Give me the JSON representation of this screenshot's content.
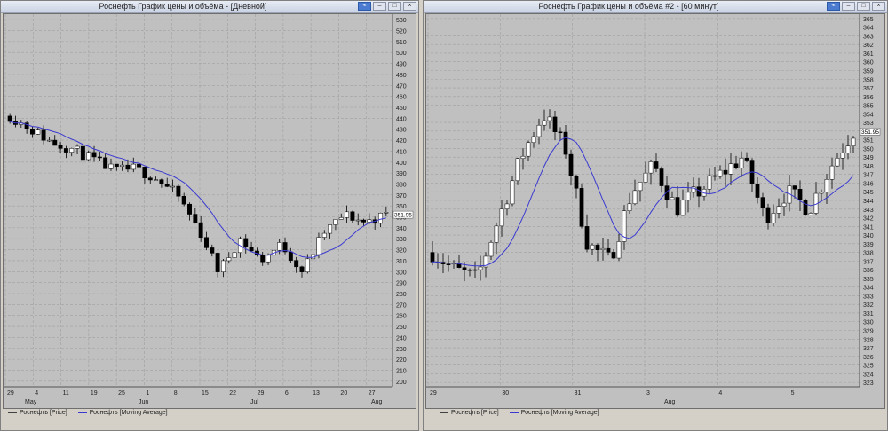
{
  "left": {
    "title": "Роснефть График цены и объёма - [Дневной]",
    "y_ticks": [
      "530",
      "520",
      "510",
      "500",
      "490",
      "480",
      "470",
      "460",
      "450",
      "440",
      "430",
      "420",
      "410",
      "400",
      "390",
      "380",
      "370",
      "360",
      "350",
      "340",
      "330",
      "320",
      "310",
      "300",
      "290",
      "280",
      "270",
      "260",
      "250",
      "240",
      "230",
      "220",
      "210",
      "200"
    ],
    "price_marker": "351.95",
    "x_day_labels": [
      "29",
      "4",
      "11",
      "19",
      "25",
      "1",
      "8",
      "15",
      "22",
      "29",
      "6",
      "13",
      "20",
      "27"
    ],
    "x_month_labels": [
      "May",
      "Jun",
      "Jul",
      "Aug"
    ],
    "legend": [
      {
        "label": "Роснефть [Price]",
        "color": "#404040"
      },
      {
        "label": "Роснефть [Moving Average]",
        "color": "#3a3ad0"
      }
    ]
  },
  "right": {
    "title": "Роснефть График цены и объёма #2 - [60 минут]",
    "y_ticks": [
      "365",
      "364",
      "363",
      "362",
      "361",
      "360",
      "359",
      "358",
      "357",
      "356",
      "355",
      "354",
      "353",
      "352",
      "351",
      "350",
      "349",
      "348",
      "347",
      "346",
      "345",
      "344",
      "343",
      "342",
      "341",
      "340",
      "339",
      "338",
      "337",
      "336",
      "335",
      "334",
      "333",
      "332",
      "331",
      "330",
      "329",
      "328",
      "327",
      "326",
      "325",
      "324",
      "323"
    ],
    "price_marker": "351.95",
    "x_day_labels": [
      "29",
      "30",
      "31",
      "3",
      "4",
      "5"
    ],
    "x_month_labels": [
      "Aug"
    ],
    "legend": [
      {
        "label": "Роснефть [Price]",
        "color": "#404040"
      },
      {
        "label": "Роснефть [Moving Average]",
        "color": "#3a3ad0"
      }
    ]
  },
  "colors": {
    "grid": "#a0a0a0",
    "plot_bg": "#c0c0c0",
    "candle": "#000000",
    "ma": "#3a3ad0"
  }
}
